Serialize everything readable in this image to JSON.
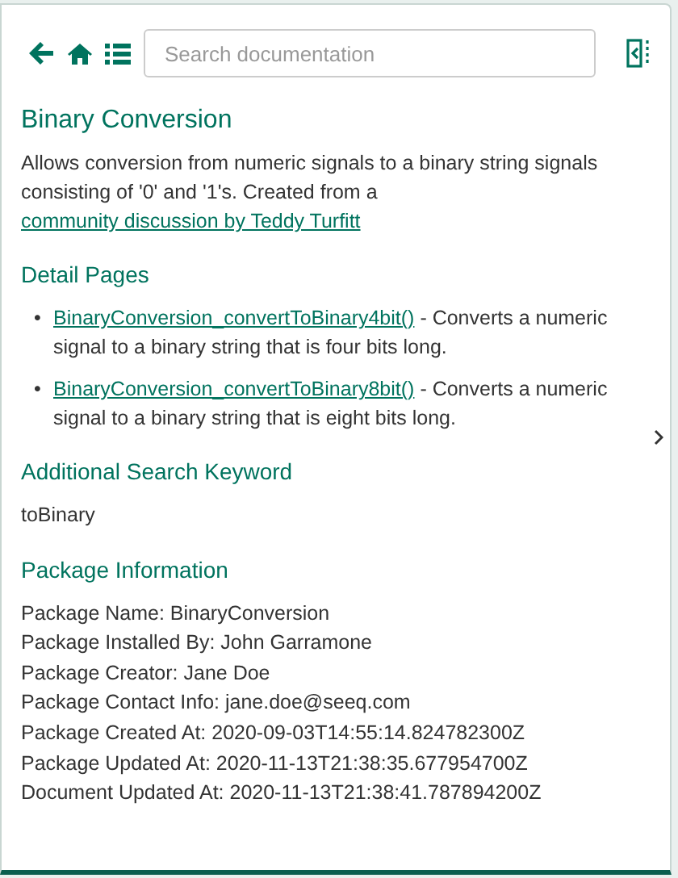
{
  "toolbar": {
    "search": {
      "placeholder": "Search documentation"
    }
  },
  "title": "Binary Conversion",
  "description": {
    "text": "Allows conversion from numeric signals to a binary string signals consisting of '0' and '1's. Created from a ",
    "link": "community discussion by Teddy Turfitt"
  },
  "sections": [
    {
      "kind": "links",
      "heading": "Detail Pages",
      "items": [
        {
          "marker": "•",
          "link": "BinaryConversion_convertToBinary4bit()",
          "text": " - Converts a numeric signal to a binary string that is four bits long."
        },
        {
          "marker": "•",
          "link": "BinaryConversion_convertToBinary8bit()",
          "text": " - Converts a numeric signal to a binary string that is eight bits long."
        }
      ]
    },
    {
      "kind": "lines",
      "heading": "Additional Search Keyword",
      "lines": [
        "toBinary"
      ]
    },
    {
      "kind": "lines",
      "heading": "Package Information",
      "lines": [
        "Package Name: BinaryConversion",
        "Package Installed By: John Garramone",
        "Package Creator: Jane Doe",
        "Package Contact Info: jane.doe@seeq.com",
        "Package Created At: 2020-09-03T14:55:14.824782300Z",
        "Package Updated At: 2020-11-13T21:38:35.677954700Z",
        "Document Updated At: 2020-11-13T21:38:41.787894200Z"
      ]
    }
  ]
}
